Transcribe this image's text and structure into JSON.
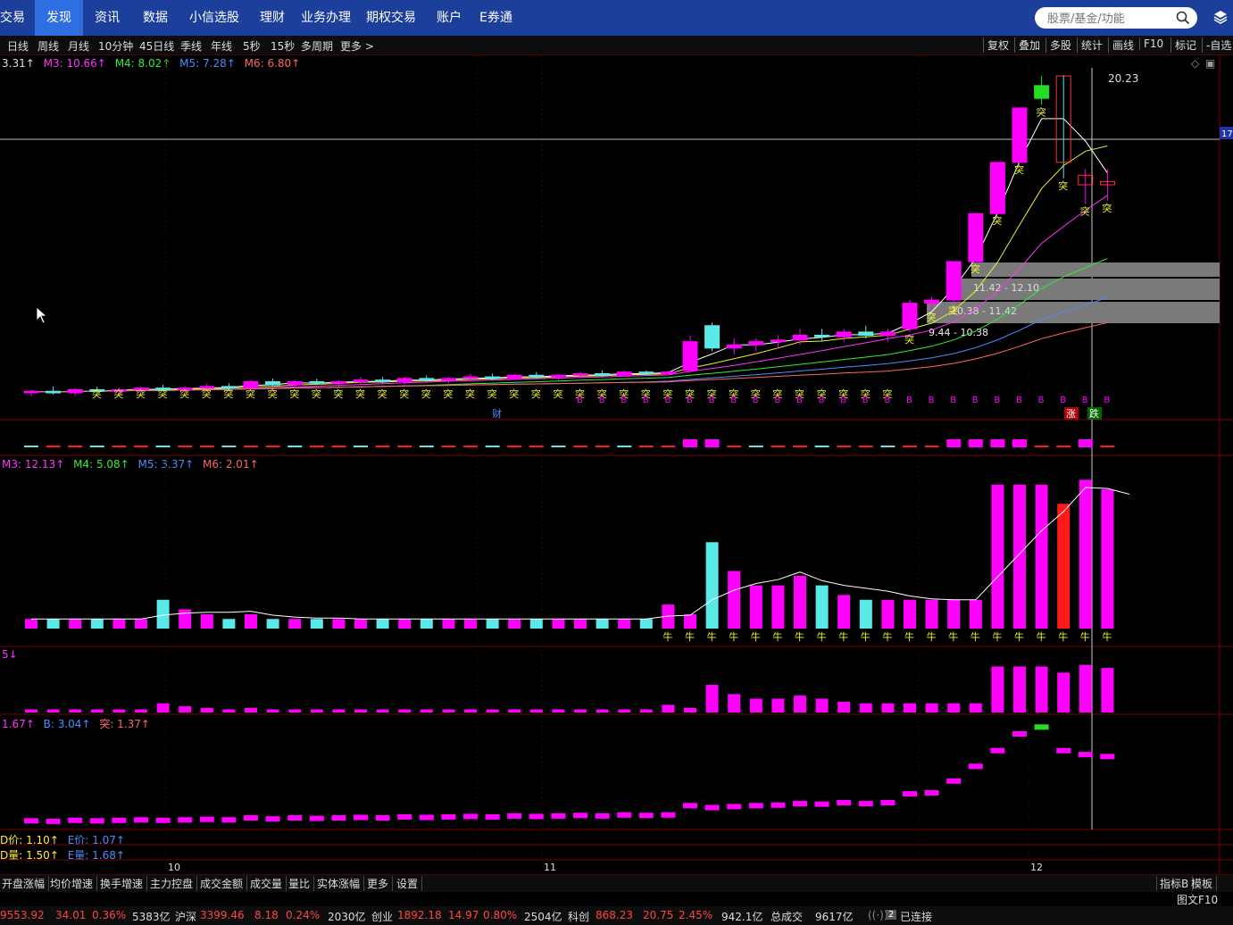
{
  "nav": {
    "items": [
      "交易",
      "发现",
      "资讯",
      "数据",
      "小信选股",
      "理财",
      "业务办理",
      "期权交易",
      "账户",
      "E券通"
    ],
    "active": "发现",
    "search_placeholder": "股票/基金/功能"
  },
  "periods": [
    "日线",
    "周线",
    "月线",
    "10分钟",
    "45日线",
    "季线",
    "年线",
    "5秒",
    "15秒",
    "多周期",
    "更多 >"
  ],
  "right_tools": [
    "复权",
    "叠加",
    "多股",
    "统计",
    "画线",
    "F10",
    "标记",
    "-自选"
  ],
  "price_legend": {
    "ma2": "3.31↑",
    "ma3": "M3: 10.66↑",
    "ma4": "M4: 8.02↑",
    "ma5": "M5: 7.28↑",
    "ma6": "M6: 6.80↑"
  },
  "vol_legend": {
    "ma3": "M3: 12.13↑",
    "ma4": "M4: 5.08↑",
    "ma5": "M5: 3.37↑",
    "ma6": "M6: 2.01↑"
  },
  "ind1_legend": "5↓",
  "ind2_legend": {
    "a": "1.67↑",
    "b": "B: 3.04↑",
    "t": "突: 1.37↑"
  },
  "dprice_legend": {
    "d": "D价: 1.10↑",
    "e": "E价: 1.07↑"
  },
  "dvol_legend": {
    "d": "D量: 1.50↑",
    "e": "E量: 1.68↑"
  },
  "price_labels": {
    "high": "20.23",
    "right_tag": "17",
    "cai": "财",
    "zhang": "涨",
    "die": "跌"
  },
  "zones": [
    "11.42 - 12.10",
    "10.38 - 11.42",
    "9.44 - 10.38"
  ],
  "markers": {
    "tu": "突",
    "niu": "牛",
    "b": "B"
  },
  "month_labels": [
    "10",
    "11",
    "12"
  ],
  "bottom_tabs": [
    "开盘涨幅",
    "均价增速",
    "换手增速",
    "主力控盘",
    "成交金额",
    "成交量",
    "量比",
    "实体涨幅",
    "更多",
    "设置"
  ],
  "bottom_right": [
    "指标B",
    "模板"
  ],
  "tuwen": "图文F10",
  "status": {
    "sh_index": "9553.92",
    "sh_chg": "34.01",
    "sh_pct": "0.36%",
    "sh_amt": "5383亿",
    "hs_label": "沪深",
    "hs_index": "3399.46",
    "hs_chg": "8.18",
    "hs_pct": "0.24%",
    "hs_amt": "2030亿",
    "cy_label": "创业",
    "cy_index": "1892.18",
    "cy_chg": "14.97",
    "cy_pct": "0.80%",
    "cy_amt": "2504亿",
    "kc_label": "科创",
    "kc_index": "868.23",
    "kc_chg": "20.75",
    "kc_pct": "2.45%",
    "kc_amt": "942.1亿",
    "total_label": "总成交",
    "total_amt": "9617亿",
    "conn_badge": "2",
    "conn": "已连接"
  },
  "colors": {
    "up": "#ff00ff",
    "upRed": "#ff1a1a",
    "down": "#5ae8e8",
    "green": "#22dd22",
    "gray": "#c8c8c8",
    "yellow": "#eeee33"
  },
  "chart_data": {
    "type": "candlestick",
    "dates_visible": [
      "10",
      "11",
      "12"
    ],
    "candles": [
      {
        "o": 10.3,
        "h": 10.4,
        "l": 10.2,
        "c": 10.35
      },
      {
        "o": 10.35,
        "h": 10.5,
        "l": 10.25,
        "c": 10.3
      },
      {
        "o": 10.3,
        "h": 10.45,
        "l": 10.2,
        "c": 10.4
      },
      {
        "o": 10.4,
        "h": 10.5,
        "l": 10.3,
        "c": 10.35
      },
      {
        "o": 10.35,
        "h": 10.45,
        "l": 10.25,
        "c": 10.4
      },
      {
        "o": 10.4,
        "h": 10.5,
        "l": 10.3,
        "c": 10.45
      },
      {
        "o": 10.45,
        "h": 10.55,
        "l": 10.35,
        "c": 10.4
      },
      {
        "o": 10.4,
        "h": 10.5,
        "l": 10.3,
        "c": 10.45
      },
      {
        "o": 10.45,
        "h": 10.6,
        "l": 10.35,
        "c": 10.5
      },
      {
        "o": 10.5,
        "h": 10.6,
        "l": 10.4,
        "c": 10.45
      },
      {
        "o": 10.45,
        "h": 10.7,
        "l": 10.4,
        "c": 10.65
      },
      {
        "o": 10.65,
        "h": 10.75,
        "l": 10.5,
        "c": 10.55
      },
      {
        "o": 10.55,
        "h": 10.7,
        "l": 10.45,
        "c": 10.65
      },
      {
        "o": 10.65,
        "h": 10.75,
        "l": 10.55,
        "c": 10.6
      },
      {
        "o": 10.6,
        "h": 10.7,
        "l": 10.5,
        "c": 10.65
      },
      {
        "o": 10.65,
        "h": 10.8,
        "l": 10.55,
        "c": 10.7
      },
      {
        "o": 10.7,
        "h": 10.8,
        "l": 10.6,
        "c": 10.65
      },
      {
        "o": 10.65,
        "h": 10.8,
        "l": 10.55,
        "c": 10.75
      },
      {
        "o": 10.75,
        "h": 10.85,
        "l": 10.65,
        "c": 10.7
      },
      {
        "o": 10.7,
        "h": 10.8,
        "l": 10.6,
        "c": 10.75
      },
      {
        "o": 10.75,
        "h": 10.9,
        "l": 10.65,
        "c": 10.8
      },
      {
        "o": 10.8,
        "h": 10.9,
        "l": 10.7,
        "c": 10.75
      },
      {
        "o": 10.75,
        "h": 10.9,
        "l": 10.7,
        "c": 10.85
      },
      {
        "o": 10.85,
        "h": 10.95,
        "l": 10.75,
        "c": 10.8
      },
      {
        "o": 10.8,
        "h": 10.9,
        "l": 10.7,
        "c": 10.85
      },
      {
        "o": 10.85,
        "h": 10.95,
        "l": 10.75,
        "c": 10.9
      },
      {
        "o": 10.9,
        "h": 11.0,
        "l": 10.8,
        "c": 10.85
      },
      {
        "o": 10.85,
        "h": 11.0,
        "l": 10.8,
        "c": 10.95
      },
      {
        "o": 10.95,
        "h": 11.0,
        "l": 10.85,
        "c": 10.9
      },
      {
        "o": 10.9,
        "h": 11.0,
        "l": 10.85,
        "c": 10.95
      },
      {
        "o": 11.0,
        "h": 12.1,
        "l": 10.95,
        "c": 11.9
      },
      {
        "o": 12.4,
        "h": 12.5,
        "l": 11.6,
        "c": 11.7
      },
      {
        "o": 11.7,
        "h": 12.0,
        "l": 11.5,
        "c": 11.8
      },
      {
        "o": 11.8,
        "h": 12.0,
        "l": 11.6,
        "c": 11.9
      },
      {
        "o": 11.9,
        "h": 12.1,
        "l": 11.7,
        "c": 11.95
      },
      {
        "o": 11.95,
        "h": 12.3,
        "l": 11.8,
        "c": 12.1
      },
      {
        "o": 12.1,
        "h": 12.3,
        "l": 11.9,
        "c": 12.05
      },
      {
        "o": 12.05,
        "h": 12.3,
        "l": 11.9,
        "c": 12.2
      },
      {
        "o": 12.2,
        "h": 12.4,
        "l": 12.0,
        "c": 12.1
      },
      {
        "o": 12.1,
        "h": 12.3,
        "l": 11.9,
        "c": 12.2
      },
      {
        "o": 12.3,
        "h": 13.2,
        "l": 12.2,
        "c": 13.1
      },
      {
        "o": 13.1,
        "h": 13.3,
        "l": 12.9,
        "c": 13.2
      },
      {
        "o": 13.2,
        "h": 14.4,
        "l": 13.1,
        "c": 14.4
      },
      {
        "o": 14.4,
        "h": 15.9,
        "l": 14.4,
        "c": 15.9
      },
      {
        "o": 15.9,
        "h": 17.5,
        "l": 15.9,
        "c": 17.5
      },
      {
        "o": 17.5,
        "h": 19.2,
        "l": 17.5,
        "c": 19.2
      },
      {
        "o": 19.5,
        "h": 20.2,
        "l": 19.3,
        "c": 19.9
      },
      {
        "o": 20.2,
        "h": 20.23,
        "l": 17.0,
        "c": 17.5
      },
      {
        "o": 16.8,
        "h": 17.3,
        "l": 16.2,
        "c": 17.1
      },
      {
        "o": 16.8,
        "h": 17.3,
        "l": 16.3,
        "c": 16.9
      }
    ],
    "volume": [
      1,
      1,
      1,
      1,
      1,
      1,
      3,
      2,
      1.5,
      1,
      1.5,
      1,
      1,
      1,
      1,
      1,
      1,
      1,
      1,
      1,
      1,
      1,
      1,
      1,
      1,
      1,
      1,
      1,
      1,
      2.5,
      1.5,
      9,
      6,
      4.5,
      4.5,
      5.5,
      4.5,
      3.5,
      3,
      3,
      3,
      3,
      3,
      3,
      15,
      15,
      15,
      13,
      15.5,
      14.5,
      12
    ]
  }
}
